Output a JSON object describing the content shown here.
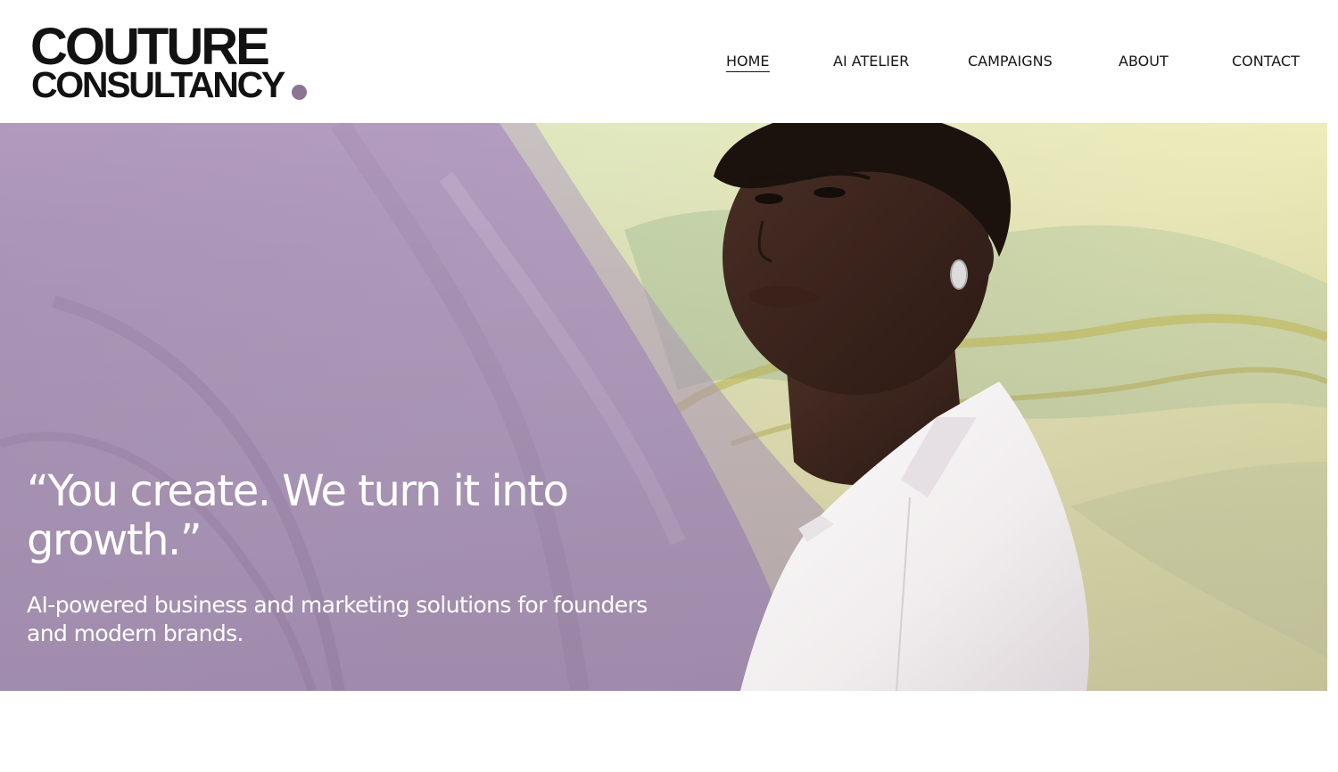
{
  "brand": {
    "line1": "COUTURE",
    "line2": "CONSULTANCY",
    "dot_color": "#8b7592"
  },
  "nav": {
    "items": [
      {
        "label": "HOME",
        "active": true
      },
      {
        "label": "AI ATELIER",
        "active": false
      },
      {
        "label": "CAMPAIGNS",
        "active": false
      },
      {
        "label": "ABOUT",
        "active": false
      },
      {
        "label": "CONTACT",
        "active": false
      }
    ]
  },
  "hero": {
    "quote": "“You create. We turn it into growth.”",
    "subtitle": "AI-powered business and marketing solutions for founders and modern brands.",
    "colors": {
      "lavender": "#b49fbf",
      "pale_yellow": "#e9e7b4",
      "sage": "#c6d6ae",
      "shirt_white": "#f4f1f0"
    }
  }
}
